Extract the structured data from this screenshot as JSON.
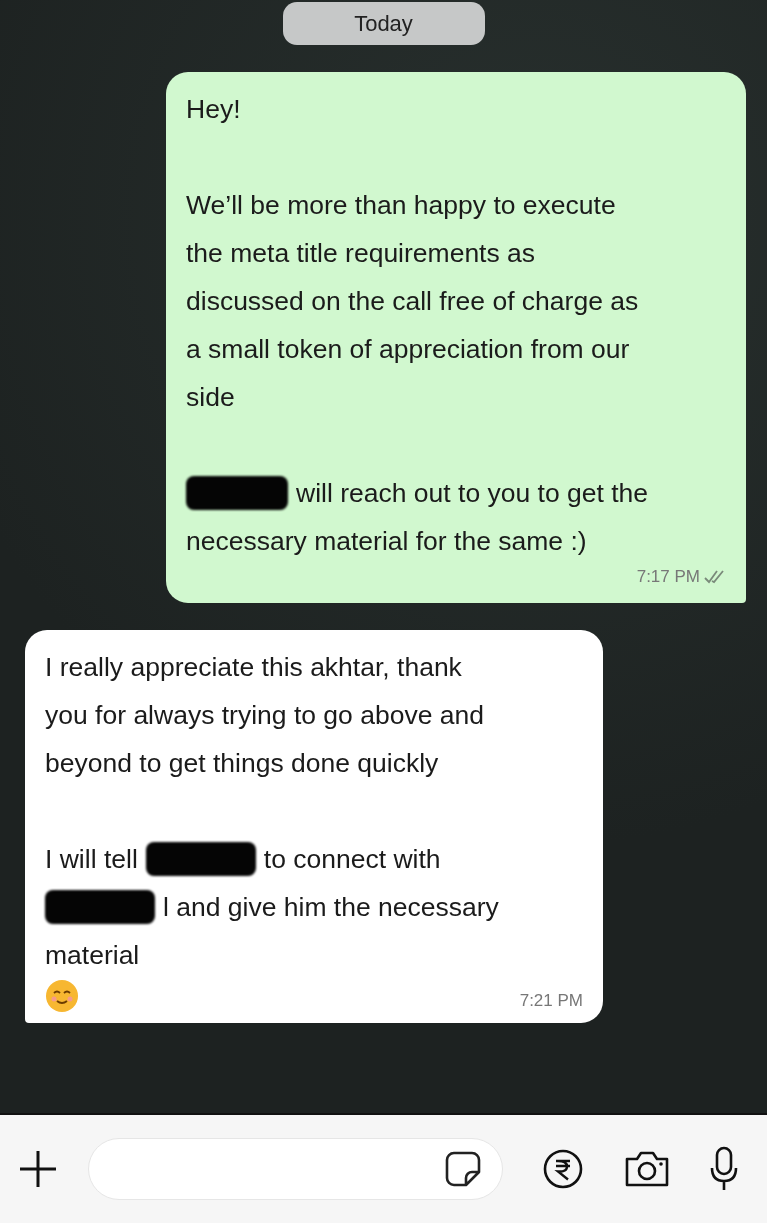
{
  "date_divider": {
    "label": "Today"
  },
  "messages": [
    {
      "kind": "outgoing",
      "time": "7:17 PM",
      "paragraphs": [
        [
          [
            {
              "kind": "text",
              "text": "Hey!"
            }
          ]
        ],
        [
          [
            {
              "kind": "text",
              "text": "We’ll be more than happy to execute"
            }
          ],
          [
            {
              "kind": "text",
              "text": "the meta title requirements as"
            }
          ],
          [
            {
              "kind": "text",
              "text": "discussed on the call free of charge as"
            }
          ],
          [
            {
              "kind": "text",
              "text": "a small token of appreciation from our"
            }
          ],
          [
            {
              "kind": "text",
              "text": "side"
            }
          ]
        ],
        [
          [
            {
              "kind": "redaction"
            },
            {
              "kind": "text",
              "text": "will reach out to you to get the"
            }
          ],
          [
            {
              "kind": "text",
              "text": "necessary material for the same :)"
            }
          ]
        ]
      ]
    },
    {
      "kind": "incoming",
      "time": "7:21 PM",
      "emoji": true,
      "paragraphs": [
        [
          [
            {
              "kind": "text",
              "text": "I really appreciate this akhtar, thank"
            }
          ],
          [
            {
              "kind": "text",
              "text": "you for always trying to go above and"
            }
          ],
          [
            {
              "kind": "text",
              "text": "beyond to get things done quickly"
            }
          ]
        ],
        [
          [
            {
              "kind": "text",
              "text": "I will tell"
            },
            {
              "kind": "redaction"
            },
            {
              "kind": "text",
              "text": "to connect with"
            }
          ],
          [
            {
              "kind": "redaction"
            },
            {
              "kind": "text",
              "text": "l and give him the necessary"
            }
          ],
          [
            {
              "kind": "text",
              "text": "material"
            }
          ]
        ]
      ]
    }
  ]
}
